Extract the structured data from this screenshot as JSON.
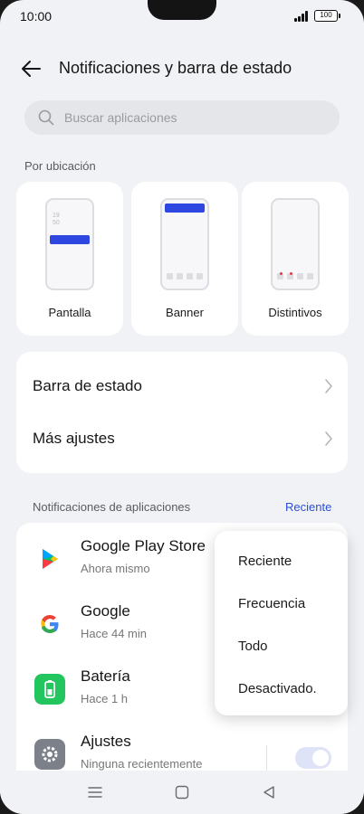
{
  "status_bar": {
    "time": "10:00",
    "battery": "100"
  },
  "header": {
    "title": "Notificaciones y barra de estado"
  },
  "search": {
    "placeholder": "Buscar aplicaciones"
  },
  "location": {
    "section_label": "Por ubicación",
    "cards": [
      {
        "label": "Pantalla",
        "preview_time": "19\n50"
      },
      {
        "label": "Banner"
      },
      {
        "label": "Distintivos"
      }
    ]
  },
  "settings": {
    "rows": [
      {
        "label": "Barra de estado"
      },
      {
        "label": "Más ajustes"
      }
    ]
  },
  "apps": {
    "section_label": "Notificaciones de aplicaciones",
    "sort_label": "Reciente",
    "items": [
      {
        "name": "Google Play Store",
        "time": "Ahora mismo",
        "icon": "play-store-icon"
      },
      {
        "name": "Google",
        "time": "Hace 44 min",
        "icon": "google-icon"
      },
      {
        "name": "Batería",
        "time": "Hace 1 h",
        "icon": "battery-app-icon"
      },
      {
        "name": "Ajustes",
        "time": "Ninguna recientemente",
        "icon": "settings-gear-icon"
      }
    ]
  },
  "sort_menu": {
    "options": [
      "Reciente",
      "Frecuencia",
      "Todo",
      "Desactivado."
    ]
  },
  "colors": {
    "accent": "#2b4fd6",
    "banner_blue": "#2d47e0",
    "battery_green": "#22c55e",
    "badge_red": "#e23b4a"
  }
}
